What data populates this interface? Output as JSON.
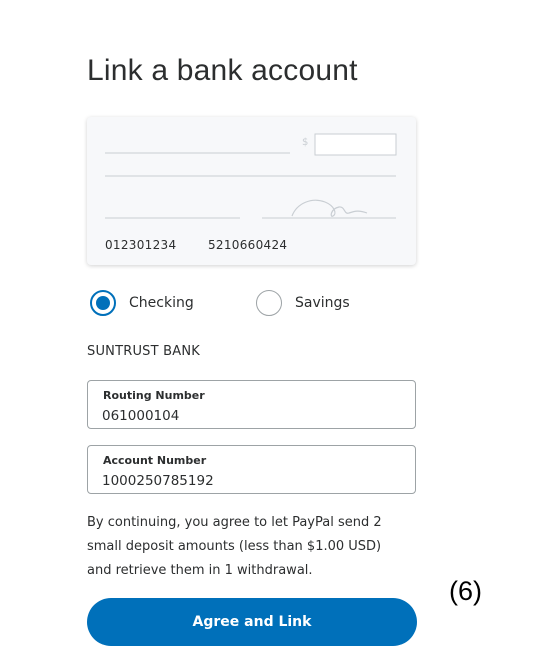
{
  "page": {
    "title": "Link a bank account"
  },
  "check_preview": {
    "dollar_sign": "$",
    "routing_number": "012301234",
    "account_number": "5210660424"
  },
  "account_type": {
    "options": [
      {
        "label": "Checking",
        "selected": true
      },
      {
        "label": "Savings",
        "selected": false
      }
    ]
  },
  "bank": {
    "name": "SUNTRUST BANK"
  },
  "form": {
    "routing": {
      "label": "Routing Number",
      "value": "061000104"
    },
    "account": {
      "label": "Account Number",
      "value": "1000250785192"
    }
  },
  "disclaimer": "By continuing, you agree to let PayPal send 2 small deposit amounts (less than $1.00 USD) and retrieve them in 1 withdrawal.",
  "step_label": "(6)",
  "cta": {
    "label": "Agree and Link",
    "color": "#0070ba"
  },
  "colors": {
    "accent": "#0070ba",
    "text": "#2c2e2f",
    "check_background": "#f7f8fa"
  }
}
